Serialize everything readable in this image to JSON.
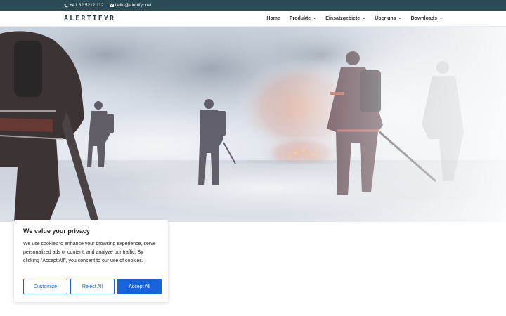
{
  "topbar": {
    "phone": "+41 32 5212 112",
    "email": "hello@alertifyr.net",
    "phone_icon": "phone-icon",
    "email_icon": "envelope-icon"
  },
  "header": {
    "logo": "ALERTIFYR",
    "nav": [
      {
        "label": "Home",
        "has_dropdown": false
      },
      {
        "label": "Produkte",
        "has_dropdown": true
      },
      {
        "label": "Einsatzgebiete",
        "has_dropdown": true
      },
      {
        "label": "Über uns",
        "has_dropdown": true
      },
      {
        "label": "Downloads",
        "has_dropdown": true
      }
    ]
  },
  "hero": {
    "image_subject": "firefighters-in-smoke"
  },
  "cookie_banner": {
    "title": "We value your privacy",
    "body": "We use cookies to enhance your browsing experience, serve personalized ads or content, and analyze our traffic. By clicking \"Accept All\", you consent to our use of cookies.",
    "customize_label": "Customize",
    "reject_label": "Reject All",
    "accept_label": "Accept All"
  },
  "colors": {
    "topbar_bg": "#2a4a56",
    "accent": "#1863dc",
    "text": "#212121"
  }
}
